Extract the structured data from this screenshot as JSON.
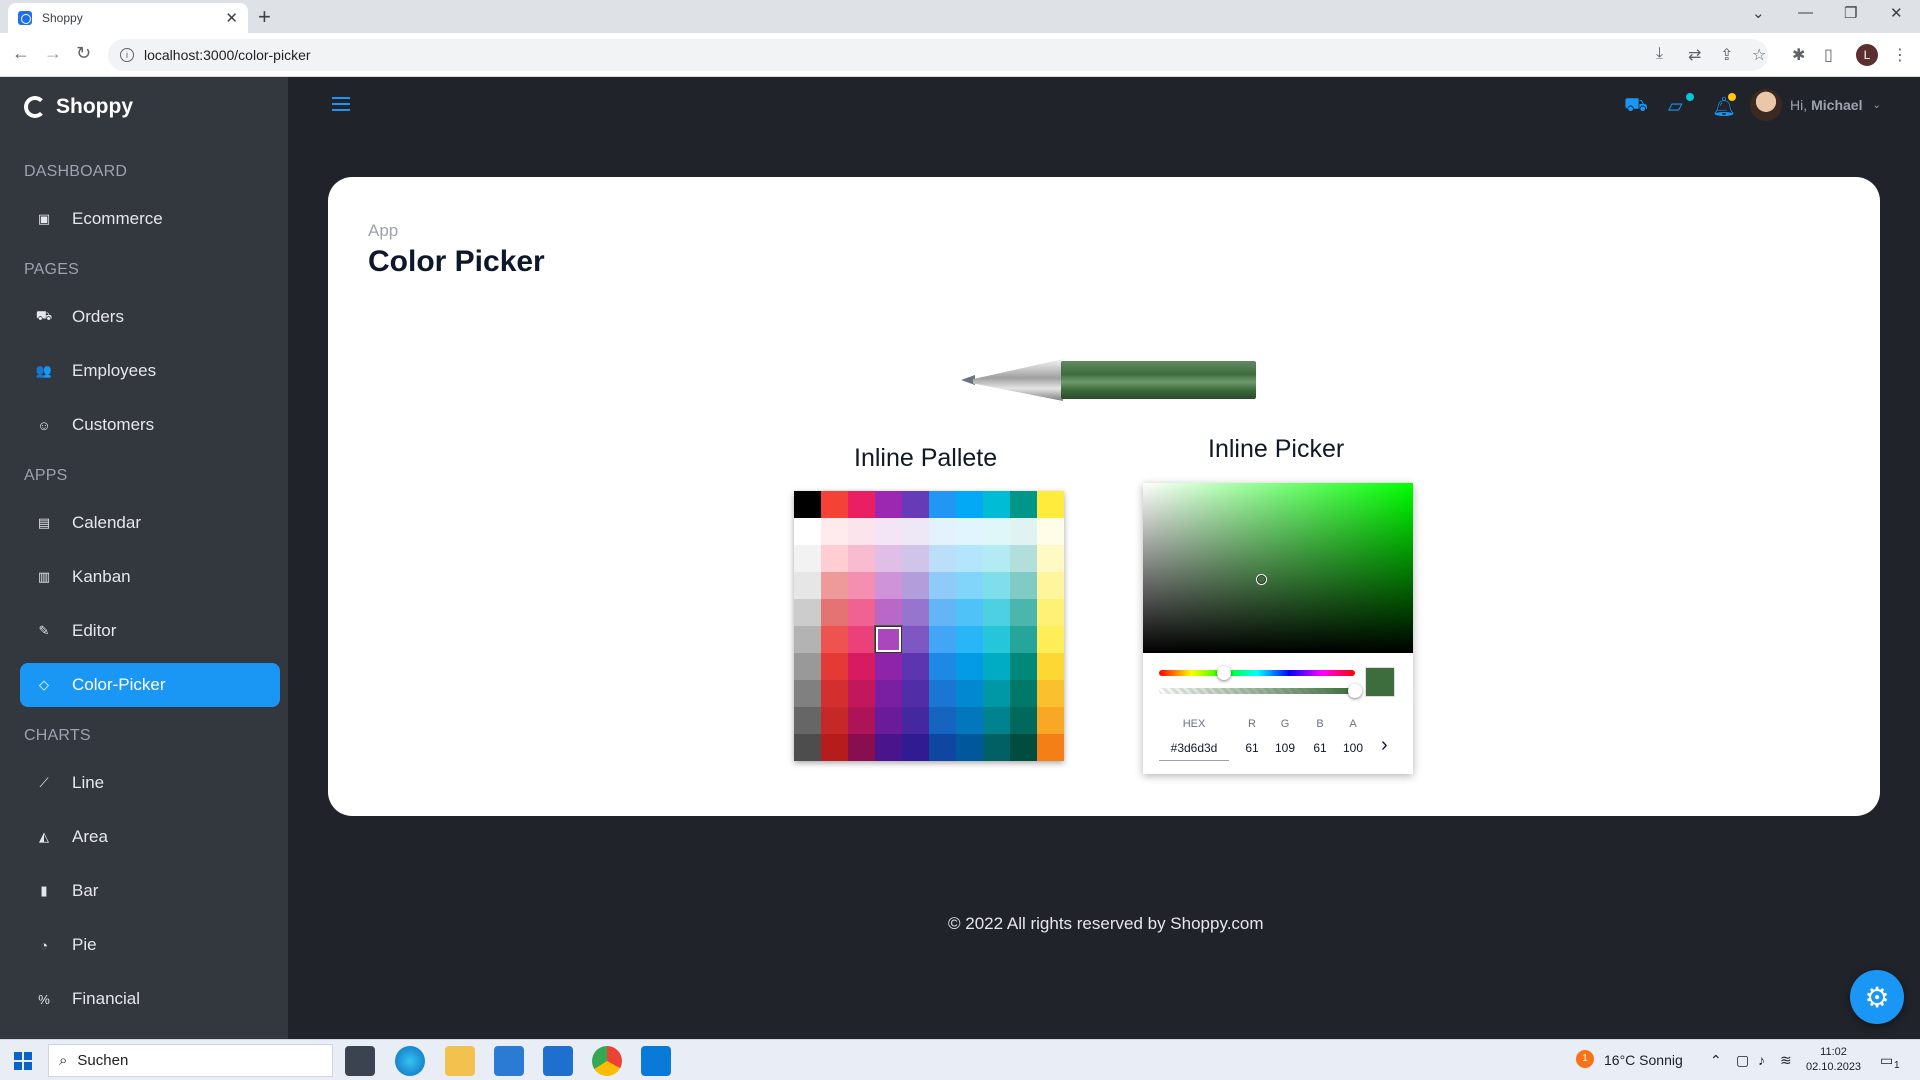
{
  "browser": {
    "tab_title": "Shoppy",
    "tab_close": "✕",
    "new_tab": "+",
    "url": "localhost:3000/color-picker",
    "profile_initial": "L"
  },
  "sidebar": {
    "brand": "Shoppy",
    "sections": [
      {
        "title": "DASHBOARD",
        "items": [
          {
            "label": "Ecommerce",
            "icon": "bag-icon"
          }
        ]
      },
      {
        "title": "PAGES",
        "items": [
          {
            "label": "Orders",
            "icon": "cart-icon"
          },
          {
            "label": "Employees",
            "icon": "people-icon"
          },
          {
            "label": "Customers",
            "icon": "contacts-icon"
          }
        ]
      },
      {
        "title": "APPS",
        "items": [
          {
            "label": "Calendar",
            "icon": "calendar-icon"
          },
          {
            "label": "Kanban",
            "icon": "board-icon"
          },
          {
            "label": "Editor",
            "icon": "edit-icon"
          },
          {
            "label": "Color-Picker",
            "icon": "eyedropper-icon",
            "active": true
          }
        ]
      },
      {
        "title": "CHARTS",
        "items": [
          {
            "label": "Line",
            "icon": "line-chart-icon"
          },
          {
            "label": "Area",
            "icon": "area-chart-icon"
          },
          {
            "label": "Bar",
            "icon": "bar-chart-icon"
          },
          {
            "label": "Pie",
            "icon": "pie-chart-icon"
          },
          {
            "label": "Financial",
            "icon": "financial-icon"
          }
        ]
      }
    ]
  },
  "topnav": {
    "greeting": "Hi,",
    "user_name": "Michael",
    "cart_badge_color": "#03c9d7",
    "chat_badge_color": "#03c9d7",
    "notification_badge_color": "#fec90f"
  },
  "page": {
    "breadcrumb": "App",
    "title": "Color Picker",
    "pen_color": "#3d6d3d",
    "palette_label": "Inline Pallete",
    "picker_label": "Inline Picker"
  },
  "palette": {
    "selected_index": 53,
    "selected_color": "#ab47bc",
    "colors": [
      "#000000",
      "#f44336",
      "#e91e63",
      "#9c27b0",
      "#673ab7",
      "#2196f3",
      "#03a9f4",
      "#00bcd4",
      "#009688",
      "#ffeb3b",
      "#ffffff",
      "#ffebee",
      "#fce4ec",
      "#f3e5f5",
      "#ede7f6",
      "#e3f2fd",
      "#e1f5fe",
      "#e0f7fa",
      "#e0f2f1",
      "#fffde7",
      "#f2f2f2",
      "#ffcdd2",
      "#f8bbd0",
      "#e1bee7",
      "#d1c4e9",
      "#bbdefb",
      "#b3e5fc",
      "#b2ebf2",
      "#b2dfdb",
      "#fff9c4",
      "#e6e6e6",
      "#ef9a9a",
      "#f48fb1",
      "#ce93d8",
      "#b39ddb",
      "#90caf9",
      "#81d4fa",
      "#80deea",
      "#80cbc4",
      "#fff59d",
      "#cccccc",
      "#e57373",
      "#f06292",
      "#ba68c8",
      "#9575cd",
      "#64b5f6",
      "#4fc3f7",
      "#4dd0e1",
      "#4db6ac",
      "#fff176",
      "#b3b3b3",
      "#ef5350",
      "#ec407a",
      "#ab47bc",
      "#7e57c2",
      "#42a5f5",
      "#29b6f6",
      "#26c6da",
      "#26a69a",
      "#ffee58",
      "#999999",
      "#e53935",
      "#d81b60",
      "#8e24aa",
      "#5e35b1",
      "#1e88e5",
      "#039be5",
      "#00acc1",
      "#00897b",
      "#fdd835",
      "#808080",
      "#d32f2f",
      "#c2185b",
      "#7b1fa2",
      "#512da8",
      "#1976d2",
      "#0288d1",
      "#0097a7",
      "#00796b",
      "#fbc02d",
      "#666666",
      "#c62828",
      "#ad1457",
      "#6a1b9a",
      "#4527a0",
      "#1565c0",
      "#0277bd",
      "#00838f",
      "#00695c",
      "#f9a825",
      "#4d4d4d",
      "#b71c1c",
      "#880e4f",
      "#4a148c",
      "#311b92",
      "#0d47a1",
      "#01579b",
      "#006064",
      "#004d40",
      "#f57f17"
    ]
  },
  "picker": {
    "hue_color": "#00ff00",
    "saturation": 0.44,
    "value": 0.43,
    "hue_fraction": 0.333,
    "alpha_fraction": 1.0,
    "current_color": "#3d6d3d",
    "labels": {
      "hex": "HEX",
      "r": "R",
      "g": "G",
      "b": "B",
      "a": "A"
    },
    "values": {
      "hex": "#3d6d3d",
      "r": "61",
      "g": "109",
      "b": "61",
      "a": "100"
    },
    "next": "›"
  },
  "footer": "© 2022 All rights reserved by Shoppy.com",
  "taskbar": {
    "search_placeholder": "Suchen",
    "weather": "16°C  Sonnig",
    "time": "11:02",
    "date": "02.10.2023",
    "notification_count": "1",
    "weather_alert": "1"
  }
}
